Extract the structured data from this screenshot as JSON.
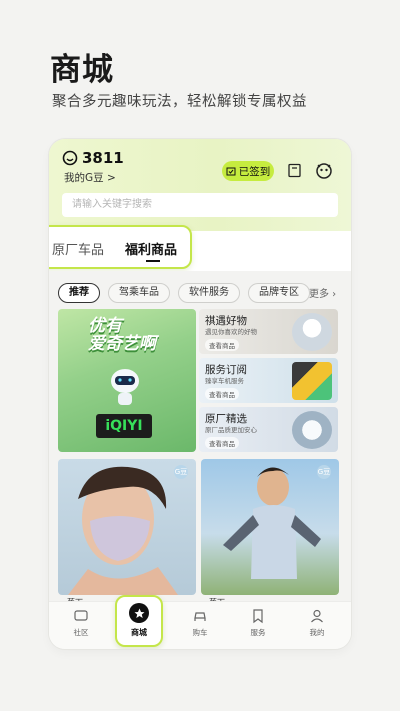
{
  "hero": {
    "title": "商城",
    "subtitle": "聚合多元趣味玩法，轻松解锁专属权益"
  },
  "header": {
    "points": "3811",
    "my_gdou": "我的G豆 >",
    "checkin_label": "已签到",
    "search_placeholder": "请输入关键字搜索"
  },
  "tabs": [
    {
      "label": "原厂车品"
    },
    {
      "label": "福利商品"
    }
  ],
  "chips": [
    {
      "label": "推荐"
    },
    {
      "label": "驾乘车品"
    },
    {
      "label": "软件服务"
    },
    {
      "label": "品牌专区"
    }
  ],
  "more_label": "更多 ›",
  "iqiyi": {
    "headline_1": "优有",
    "headline_2": "爱奇艺啊",
    "logo": "iQIYI"
  },
  "small_cards": [
    {
      "title": "祺遇好物",
      "desc": "遇见你喜欢的好物",
      "button": "查看商品"
    },
    {
      "title": "服务订阅",
      "desc": "臻享车机服务",
      "button": "查看商品"
    },
    {
      "title": "原厂精选",
      "desc": "原厂品质更加安心",
      "button": "查看商品"
    }
  ],
  "photo_badge": "G豆",
  "under_labels": [
    "蕉下",
    "蕉下"
  ],
  "bottom_nav": [
    {
      "label": "社区"
    },
    {
      "label": "商城"
    },
    {
      "label": "购车"
    },
    {
      "label": "服务"
    },
    {
      "label": "我的"
    }
  ],
  "colors": {
    "accent": "#c4e64a",
    "checkin_bg": "#c6ec3f"
  }
}
